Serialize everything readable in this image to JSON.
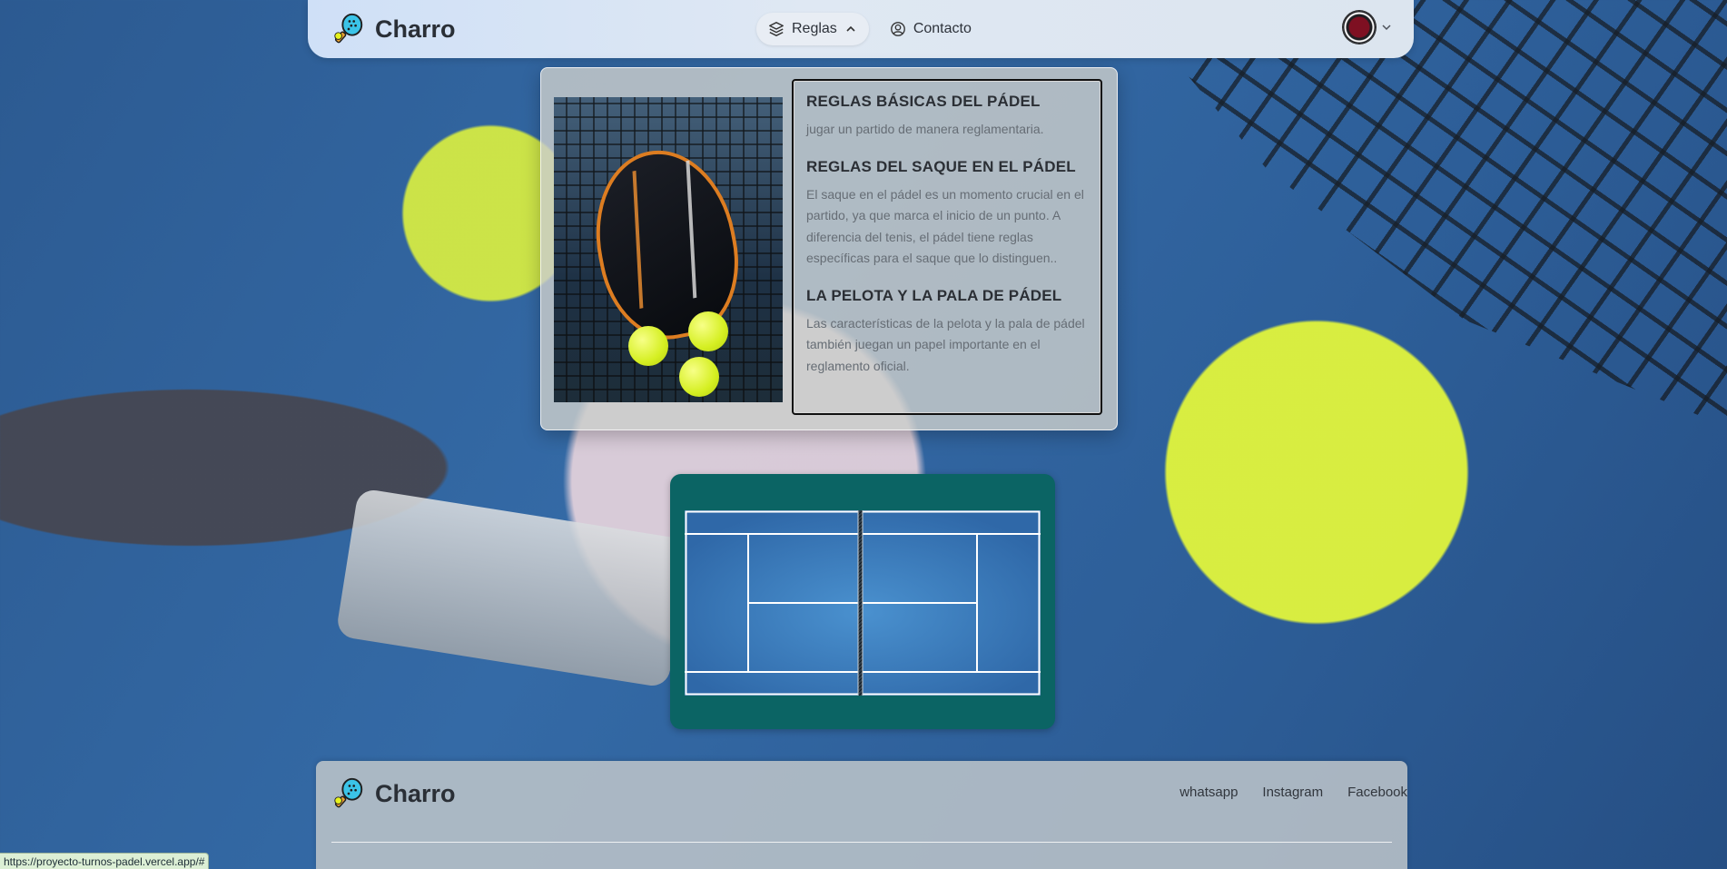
{
  "brand": {
    "name": "Charro",
    "logo_icon": "padel-racket-icon"
  },
  "nav": {
    "links": [
      {
        "label": "Reglas",
        "icon": "layers-icon",
        "trailing_icon": "chevron-up-icon",
        "active": true
      },
      {
        "label": "Contacto",
        "icon": "user-circle-icon",
        "active": false
      }
    ],
    "avatar_icon": "avatar",
    "avatar_menu_icon": "chevron-down-icon"
  },
  "rules_menu": {
    "image": "padel-racket-and-balls-photo",
    "items": [
      {
        "title": "REGLAS BÁSICAS DEL PÁDEL",
        "text": "jugar un partido de manera reglamentaria."
      },
      {
        "title": "REGLAS DEL SAQUE EN EL PÁDEL",
        "text": "El saque en el pádel es un momento crucial en el partido, ya que marca el inicio de un punto. A diferencia del tenis, el pádel tiene reglas específicas para el saque que lo distinguen.."
      },
      {
        "title": "LA PELOTA Y LA PALA DE PÁDEL",
        "text": "Las características de la pelota y la pala de pádel también juegan un papel importante en el reglamento oficial."
      }
    ]
  },
  "court": {
    "icon": "padel-court-diagram",
    "colors": {
      "surround": "#0b6464",
      "court": "#2f6fae",
      "lines": "#ffffff"
    }
  },
  "footer": {
    "brand_name": "Charro",
    "links": [
      "whatsapp",
      "Instagram",
      "Facebook"
    ]
  },
  "status_bar": {
    "url": "https://proyecto-turnos-padel.vercel.app/#"
  }
}
